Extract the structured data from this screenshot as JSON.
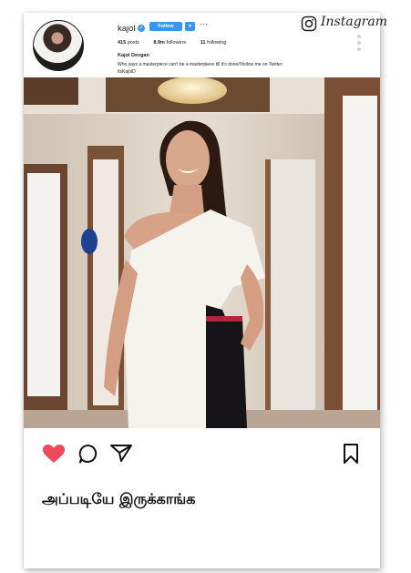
{
  "profile": {
    "username": "kajol",
    "follow_label": "Follow",
    "dropdown_label": "▾",
    "more_label": "···",
    "stats": [
      {
        "value": "415",
        "label": "posts"
      },
      {
        "value": "8.9m",
        "label": "followers"
      },
      {
        "value": "11",
        "label": "following"
      }
    ],
    "full_name": "Kajol Devgan",
    "bio_line1": "Who says a masterpiece can't be a masterpiece till it's done//\\follow me on Twitter:",
    "bio_line2": "itsKajolD"
  },
  "brand": {
    "name": "Instagram",
    "icon": "instagram-camera-icon"
  },
  "post": {
    "photo_description_icon": "photo",
    "actions": [
      {
        "name": "like-heart-icon",
        "state": "liked",
        "color": "#ed4956"
      },
      {
        "name": "comment-bubble-icon"
      },
      {
        "name": "share-paper-plane-icon"
      },
      {
        "name": "save-bookmark-icon"
      }
    ],
    "caption": "அப்படியே இருக்காங்க"
  },
  "colors": {
    "accent": "#3897f0",
    "like": "#ed4956"
  }
}
